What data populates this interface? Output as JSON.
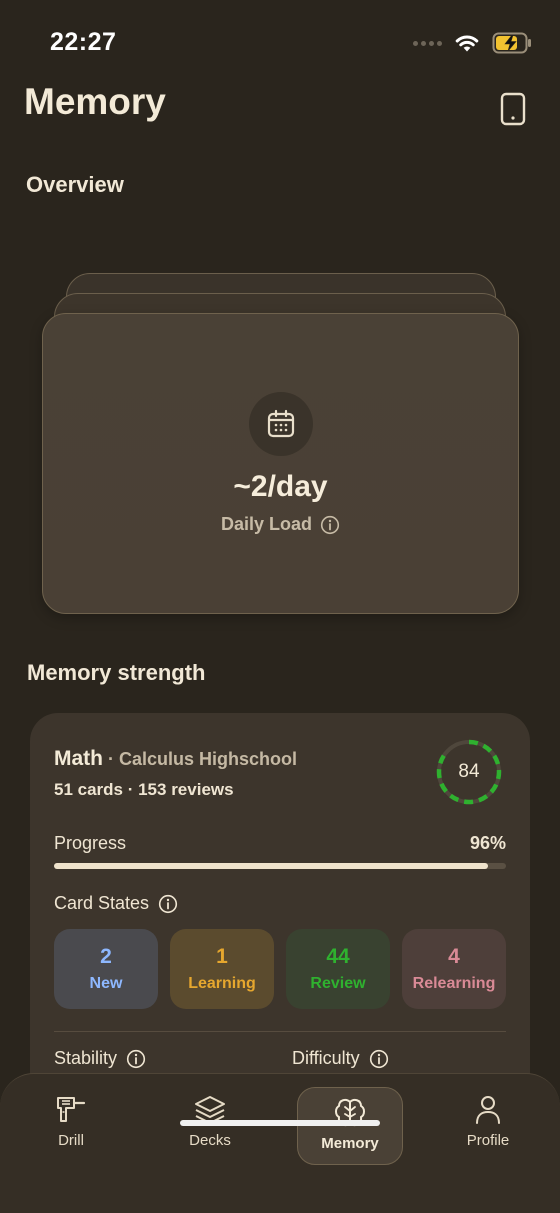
{
  "status_bar": {
    "time": "22:27"
  },
  "header": {
    "title": "Memory"
  },
  "overview": {
    "title": "Overview",
    "load_value": "~2/day",
    "load_label": "Daily Load"
  },
  "memory_strength": {
    "title": "Memory strength",
    "deck": {
      "subject": "Math",
      "separator": "·",
      "name": "Calculus Highschool",
      "stats": "51 cards · 153 reviews",
      "score": "84",
      "progress_label": "Progress",
      "progress_value": "96%",
      "progress_fraction": 0.96,
      "states_label": "Card States",
      "states": [
        {
          "count": "2",
          "name": "New",
          "color": "#8eb8ff"
        },
        {
          "count": "1",
          "name": "Learning",
          "color": "#e6a72e"
        },
        {
          "count": "44",
          "name": "Review",
          "color": "#2fb12f"
        },
        {
          "count": "4",
          "name": "Relearning",
          "color": "#d98a96"
        }
      ],
      "stability_label": "Stability",
      "difficulty_label": "Difficulty"
    }
  },
  "tabs": [
    {
      "label": "Drill",
      "icon": "drill-icon"
    },
    {
      "label": "Decks",
      "icon": "layers-icon"
    },
    {
      "label": "Memory",
      "icon": "brain-icon",
      "active": true
    },
    {
      "label": "Profile",
      "icon": "person-icon"
    }
  ],
  "colors": {
    "background": "#2a251d",
    "accent_green": "#2fb12f",
    "card": "#3d352c"
  }
}
